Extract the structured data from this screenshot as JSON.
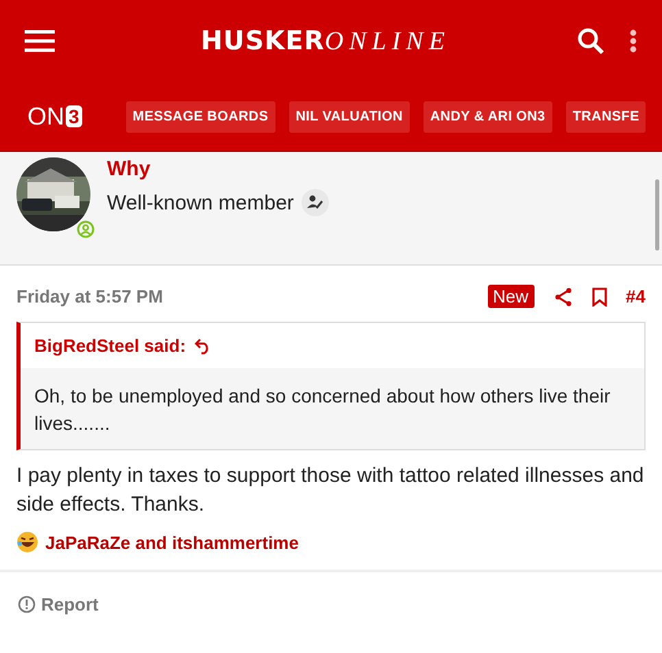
{
  "header": {
    "logo_bold": "HUSKER",
    "logo_italic": "ONLINE"
  },
  "nav": {
    "brand_main": "ON",
    "brand_boxed": "3",
    "items": [
      {
        "label": "MESSAGE BOARDS"
      },
      {
        "label": "NIL VALUATION"
      },
      {
        "label": "ANDY & ARI ON3"
      },
      {
        "label": "TRANSFE"
      }
    ]
  },
  "author": {
    "name": "Why",
    "title": "Well-known member",
    "online": true
  },
  "post": {
    "time": "Friday at 5:57 PM",
    "badge": "New",
    "number": "#4",
    "quote": {
      "author": "BigRedSteel said:",
      "text": "Oh, to be unemployed and so concerned about how others live their lives......."
    },
    "body": "I pay plenty in taxes to support those with tattoo related illnesses and side effects. Thanks.",
    "reactions": "JaPaRaZe and itshammertime",
    "report": "Report"
  }
}
